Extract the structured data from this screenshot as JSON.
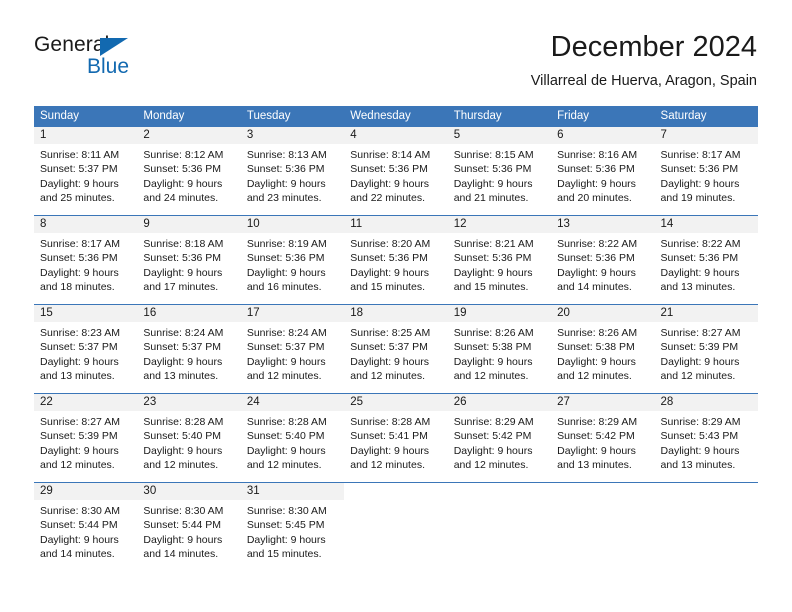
{
  "brand": {
    "name_part1": "General",
    "name_part2": "Blue",
    "triangle_color": "#1269b0"
  },
  "title": {
    "month_year": "December 2024",
    "location": "Villarreal de Huerva, Aragon, Spain"
  },
  "theme": {
    "header_blue": "#3b76b8",
    "daynum_background": "#f2f2f2",
    "text": "#1a1a1a"
  },
  "calendar": {
    "weekday_headers": [
      "Sunday",
      "Monday",
      "Tuesday",
      "Wednesday",
      "Thursday",
      "Friday",
      "Saturday"
    ],
    "weeks": [
      [
        {
          "day": "1",
          "sunrise": "Sunrise: 8:11 AM",
          "sunset": "Sunset: 5:37 PM",
          "daylight1": "Daylight: 9 hours",
          "daylight2": "and 25 minutes."
        },
        {
          "day": "2",
          "sunrise": "Sunrise: 8:12 AM",
          "sunset": "Sunset: 5:36 PM",
          "daylight1": "Daylight: 9 hours",
          "daylight2": "and 24 minutes."
        },
        {
          "day": "3",
          "sunrise": "Sunrise: 8:13 AM",
          "sunset": "Sunset: 5:36 PM",
          "daylight1": "Daylight: 9 hours",
          "daylight2": "and 23 minutes."
        },
        {
          "day": "4",
          "sunrise": "Sunrise: 8:14 AM",
          "sunset": "Sunset: 5:36 PM",
          "daylight1": "Daylight: 9 hours",
          "daylight2": "and 22 minutes."
        },
        {
          "day": "5",
          "sunrise": "Sunrise: 8:15 AM",
          "sunset": "Sunset: 5:36 PM",
          "daylight1": "Daylight: 9 hours",
          "daylight2": "and 21 minutes."
        },
        {
          "day": "6",
          "sunrise": "Sunrise: 8:16 AM",
          "sunset": "Sunset: 5:36 PM",
          "daylight1": "Daylight: 9 hours",
          "daylight2": "and 20 minutes."
        },
        {
          "day": "7",
          "sunrise": "Sunrise: 8:17 AM",
          "sunset": "Sunset: 5:36 PM",
          "daylight1": "Daylight: 9 hours",
          "daylight2": "and 19 minutes."
        }
      ],
      [
        {
          "day": "8",
          "sunrise": "Sunrise: 8:17 AM",
          "sunset": "Sunset: 5:36 PM",
          "daylight1": "Daylight: 9 hours",
          "daylight2": "and 18 minutes."
        },
        {
          "day": "9",
          "sunrise": "Sunrise: 8:18 AM",
          "sunset": "Sunset: 5:36 PM",
          "daylight1": "Daylight: 9 hours",
          "daylight2": "and 17 minutes."
        },
        {
          "day": "10",
          "sunrise": "Sunrise: 8:19 AM",
          "sunset": "Sunset: 5:36 PM",
          "daylight1": "Daylight: 9 hours",
          "daylight2": "and 16 minutes."
        },
        {
          "day": "11",
          "sunrise": "Sunrise: 8:20 AM",
          "sunset": "Sunset: 5:36 PM",
          "daylight1": "Daylight: 9 hours",
          "daylight2": "and 15 minutes."
        },
        {
          "day": "12",
          "sunrise": "Sunrise: 8:21 AM",
          "sunset": "Sunset: 5:36 PM",
          "daylight1": "Daylight: 9 hours",
          "daylight2": "and 15 minutes."
        },
        {
          "day": "13",
          "sunrise": "Sunrise: 8:22 AM",
          "sunset": "Sunset: 5:36 PM",
          "daylight1": "Daylight: 9 hours",
          "daylight2": "and 14 minutes."
        },
        {
          "day": "14",
          "sunrise": "Sunrise: 8:22 AM",
          "sunset": "Sunset: 5:36 PM",
          "daylight1": "Daylight: 9 hours",
          "daylight2": "and 13 minutes."
        }
      ],
      [
        {
          "day": "15",
          "sunrise": "Sunrise: 8:23 AM",
          "sunset": "Sunset: 5:37 PM",
          "daylight1": "Daylight: 9 hours",
          "daylight2": "and 13 minutes."
        },
        {
          "day": "16",
          "sunrise": "Sunrise: 8:24 AM",
          "sunset": "Sunset: 5:37 PM",
          "daylight1": "Daylight: 9 hours",
          "daylight2": "and 13 minutes."
        },
        {
          "day": "17",
          "sunrise": "Sunrise: 8:24 AM",
          "sunset": "Sunset: 5:37 PM",
          "daylight1": "Daylight: 9 hours",
          "daylight2": "and 12 minutes."
        },
        {
          "day": "18",
          "sunrise": "Sunrise: 8:25 AM",
          "sunset": "Sunset: 5:37 PM",
          "daylight1": "Daylight: 9 hours",
          "daylight2": "and 12 minutes."
        },
        {
          "day": "19",
          "sunrise": "Sunrise: 8:26 AM",
          "sunset": "Sunset: 5:38 PM",
          "daylight1": "Daylight: 9 hours",
          "daylight2": "and 12 minutes."
        },
        {
          "day": "20",
          "sunrise": "Sunrise: 8:26 AM",
          "sunset": "Sunset: 5:38 PM",
          "daylight1": "Daylight: 9 hours",
          "daylight2": "and 12 minutes."
        },
        {
          "day": "21",
          "sunrise": "Sunrise: 8:27 AM",
          "sunset": "Sunset: 5:39 PM",
          "daylight1": "Daylight: 9 hours",
          "daylight2": "and 12 minutes."
        }
      ],
      [
        {
          "day": "22",
          "sunrise": "Sunrise: 8:27 AM",
          "sunset": "Sunset: 5:39 PM",
          "daylight1": "Daylight: 9 hours",
          "daylight2": "and 12 minutes."
        },
        {
          "day": "23",
          "sunrise": "Sunrise: 8:28 AM",
          "sunset": "Sunset: 5:40 PM",
          "daylight1": "Daylight: 9 hours",
          "daylight2": "and 12 minutes."
        },
        {
          "day": "24",
          "sunrise": "Sunrise: 8:28 AM",
          "sunset": "Sunset: 5:40 PM",
          "daylight1": "Daylight: 9 hours",
          "daylight2": "and 12 minutes."
        },
        {
          "day": "25",
          "sunrise": "Sunrise: 8:28 AM",
          "sunset": "Sunset: 5:41 PM",
          "daylight1": "Daylight: 9 hours",
          "daylight2": "and 12 minutes."
        },
        {
          "day": "26",
          "sunrise": "Sunrise: 8:29 AM",
          "sunset": "Sunset: 5:42 PM",
          "daylight1": "Daylight: 9 hours",
          "daylight2": "and 12 minutes."
        },
        {
          "day": "27",
          "sunrise": "Sunrise: 8:29 AM",
          "sunset": "Sunset: 5:42 PM",
          "daylight1": "Daylight: 9 hours",
          "daylight2": "and 13 minutes."
        },
        {
          "day": "28",
          "sunrise": "Sunrise: 8:29 AM",
          "sunset": "Sunset: 5:43 PM",
          "daylight1": "Daylight: 9 hours",
          "daylight2": "and 13 minutes."
        }
      ],
      [
        {
          "day": "29",
          "sunrise": "Sunrise: 8:30 AM",
          "sunset": "Sunset: 5:44 PM",
          "daylight1": "Daylight: 9 hours",
          "daylight2": "and 14 minutes."
        },
        {
          "day": "30",
          "sunrise": "Sunrise: 8:30 AM",
          "sunset": "Sunset: 5:44 PM",
          "daylight1": "Daylight: 9 hours",
          "daylight2": "and 14 minutes."
        },
        {
          "day": "31",
          "sunrise": "Sunrise: 8:30 AM",
          "sunset": "Sunset: 5:45 PM",
          "daylight1": "Daylight: 9 hours",
          "daylight2": "and 15 minutes."
        },
        {
          "day": "",
          "sunrise": "",
          "sunset": "",
          "daylight1": "",
          "daylight2": ""
        },
        {
          "day": "",
          "sunrise": "",
          "sunset": "",
          "daylight1": "",
          "daylight2": ""
        },
        {
          "day": "",
          "sunrise": "",
          "sunset": "",
          "daylight1": "",
          "daylight2": ""
        },
        {
          "day": "",
          "sunrise": "",
          "sunset": "",
          "daylight1": "",
          "daylight2": ""
        }
      ]
    ]
  }
}
